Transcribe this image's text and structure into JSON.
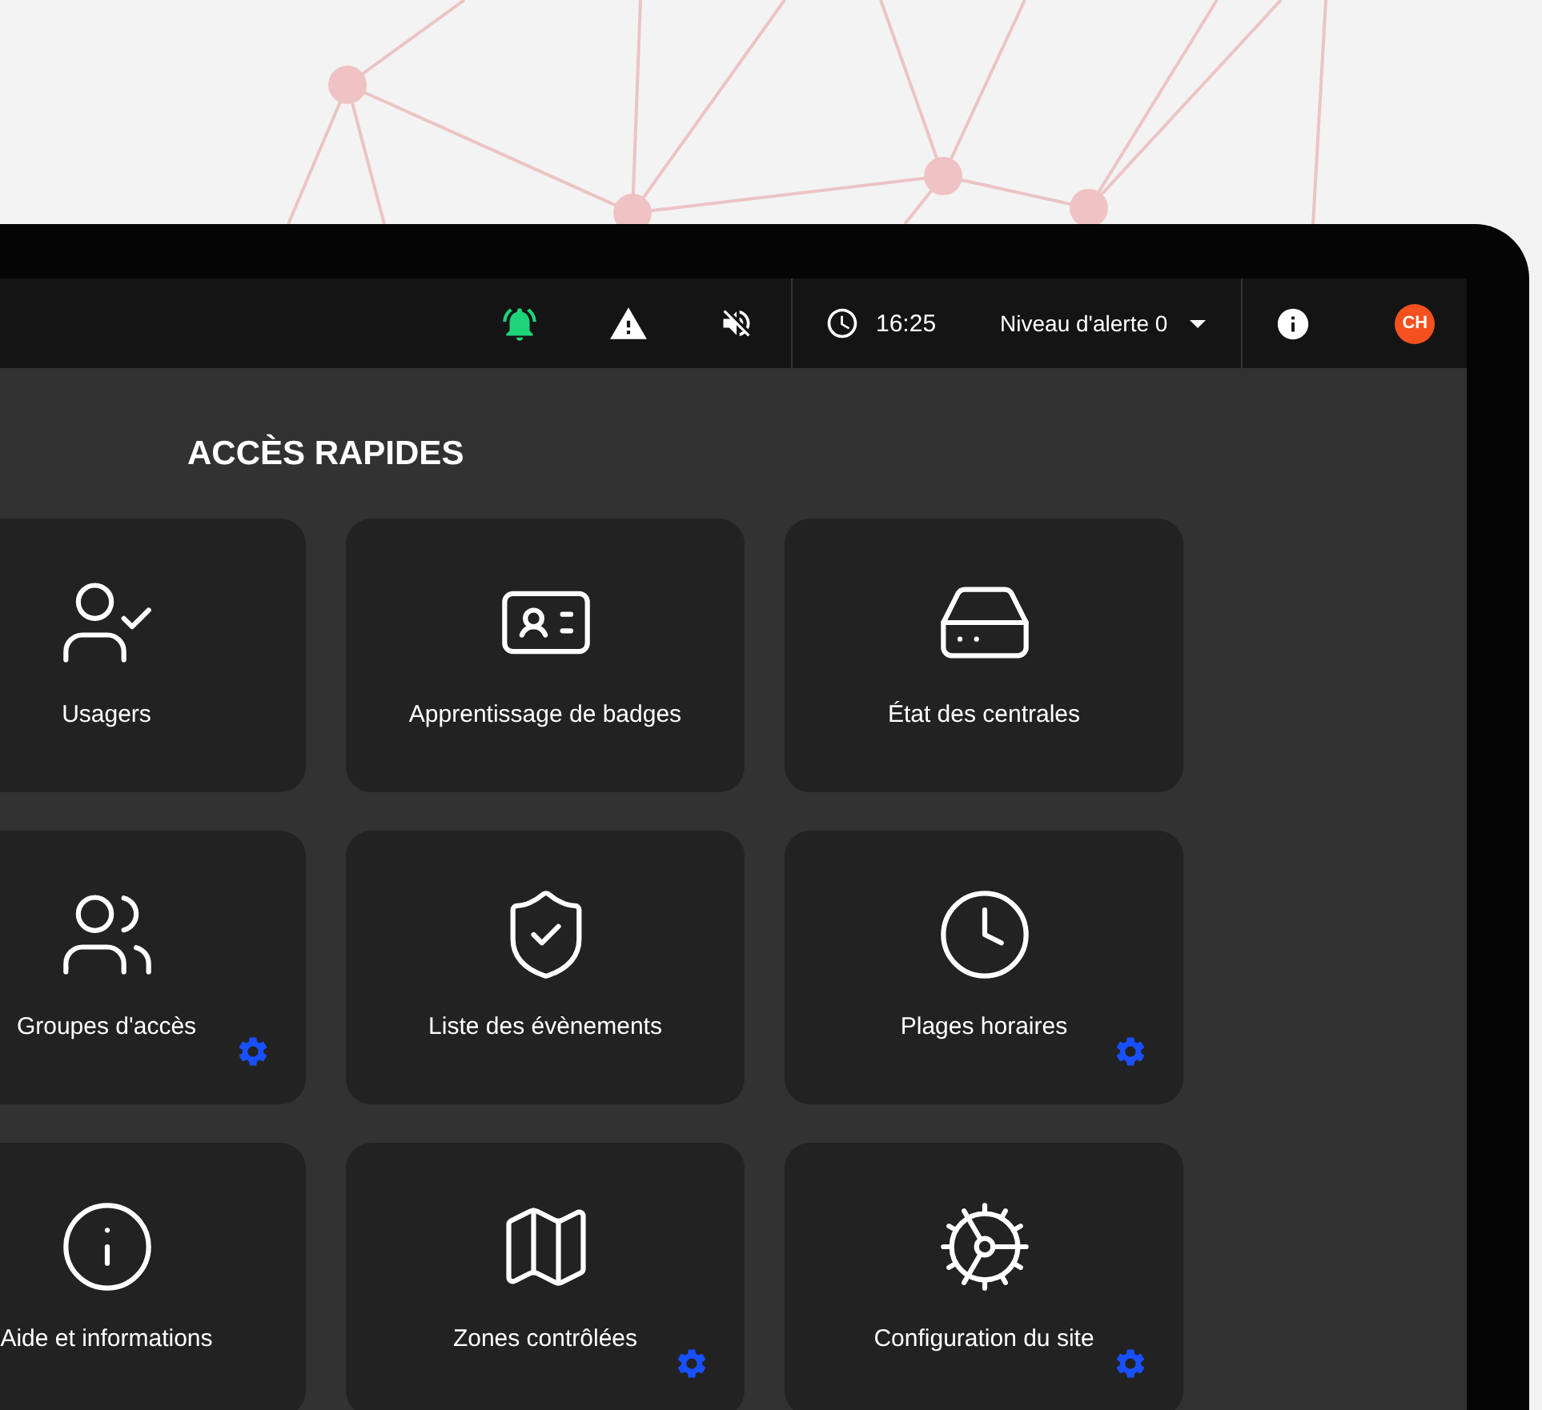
{
  "topbar": {
    "time": "16:25",
    "alert_level": "Niveau d'alerte 0",
    "avatar": "CH"
  },
  "section_title": "ACCÈS RAPIDES",
  "tiles": [
    {
      "label": "Usagers",
      "configurable": false
    },
    {
      "label": "Apprentissage de badges",
      "configurable": false
    },
    {
      "label": "État des centrales",
      "configurable": false
    },
    {
      "label": "Groupes d'accès",
      "configurable": true
    },
    {
      "label": "Liste des évènements",
      "configurable": false
    },
    {
      "label": "Plages horaires",
      "configurable": true
    },
    {
      "label": "Aide et informations",
      "configurable": false
    },
    {
      "label": "Zones contrôlées",
      "configurable": true
    },
    {
      "label": "Configuration du site",
      "configurable": true
    }
  ]
}
